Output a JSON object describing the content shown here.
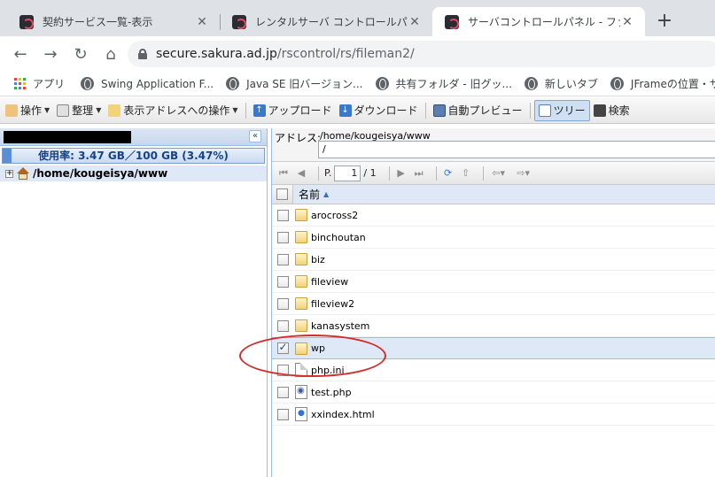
{
  "tabs": [
    {
      "title": "契約サービス一覧-表示",
      "close": "✕"
    },
    {
      "title": "レンタルサーバ コントロールパネル",
      "close": "✕"
    },
    {
      "title": "サーバコントロールパネル - ファイルマネ",
      "close": "✕"
    }
  ],
  "new_tab": "+",
  "nav": {
    "back": "←",
    "forward": "→",
    "reload": "↻",
    "home": "⌂"
  },
  "address_bar": {
    "host": "secure.sakura.ad.jp",
    "path": "/rscontrol/rs/fileman2/"
  },
  "bookmarks": [
    {
      "label": "アプリ",
      "icon": "apps-grid-icon"
    },
    {
      "label": "Swing Application F...",
      "icon": "globe-icon"
    },
    {
      "label": "Java SE 旧バージョン...",
      "icon": "globe-icon"
    },
    {
      "label": "共有フォルダ - 旧グッ...",
      "icon": "globe-icon"
    },
    {
      "label": "新しいタブ",
      "icon": "globe-icon"
    },
    {
      "label": "JFrameの位置・サイズ...",
      "icon": "globe-icon"
    }
  ],
  "toolbar": {
    "operation": "操作",
    "organize": "整理",
    "address_ops": "表示アドレスへの操作",
    "upload": "アップロード",
    "download": "ダウンロード",
    "auto_preview": "自動プレビュー",
    "tree": "ツリー",
    "search": "検索"
  },
  "left_pane": {
    "collapse": "«",
    "usage_text": "使用率: 3.47 GB／100 GB (3.47%)",
    "usage_percent": 3.47,
    "tree_root": "/home/kougeisya/www",
    "expander": "+"
  },
  "right_pane": {
    "address_label": "アドレス:",
    "address_path": "/home/kougeisya/www",
    "address_input": "/",
    "pager": {
      "page_label": "P.",
      "page_value": "1",
      "total": "/ 1"
    },
    "column_name": "名前",
    "sort_indicator": "▲",
    "files": [
      {
        "name": "arocross2",
        "type": "folder",
        "checked": false
      },
      {
        "name": "binchoutan",
        "type": "folder",
        "checked": false
      },
      {
        "name": "biz",
        "type": "folder",
        "checked": false
      },
      {
        "name": "fileview",
        "type": "folder",
        "checked": false
      },
      {
        "name": "fileview2",
        "type": "folder",
        "checked": false
      },
      {
        "name": "kanasystem",
        "type": "folder",
        "checked": false
      },
      {
        "name": "wp",
        "type": "folder",
        "checked": true
      },
      {
        "name": "php.ini",
        "type": "doc",
        "checked": false
      },
      {
        "name": "test.php",
        "type": "php",
        "checked": false
      },
      {
        "name": "xxindex.html",
        "type": "html",
        "checked": false
      }
    ]
  },
  "colors": {
    "tabstrip": "#dee1e6",
    "accent_blue": "#15428b",
    "selection": "#dfe8f6",
    "annotation_red": "#d22d2d"
  }
}
